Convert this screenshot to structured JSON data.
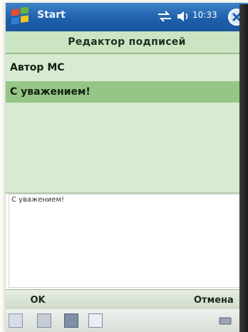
{
  "titlebar": {
    "start_label": "Start",
    "time": "10:33",
    "colors": {
      "bar": "#2062ac",
      "text": "#ffffff"
    }
  },
  "editor": {
    "title": "Редактор подписей"
  },
  "signatures": {
    "items": [
      {
        "label": "Автор МС",
        "selected": false
      },
      {
        "label": "С уважением!",
        "selected": true
      }
    ]
  },
  "signature_text": {
    "value": "С уважением!"
  },
  "menubar": {
    "ok_label": "OK",
    "cancel_label": "Отмена"
  },
  "icons": {
    "start": "windows-flag-icon",
    "sync": "sync-arrows-icon",
    "speaker": "speaker-icon",
    "close": "close-icon",
    "keyboard": "keyboard-icon"
  },
  "colors": {
    "list_bg": "#d6ebd0",
    "selected_bg": "#95c686",
    "header_bg": "#cbe4c2"
  }
}
